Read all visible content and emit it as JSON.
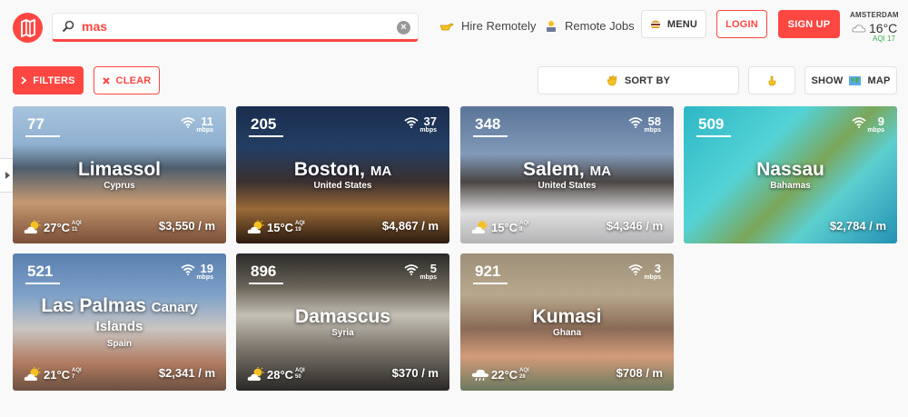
{
  "header": {
    "search": {
      "value": "mas",
      "placeholder": ""
    },
    "nav": {
      "hire_remotely": "Hire Remotely",
      "remote_jobs": "Remote Jobs"
    },
    "buttons": {
      "menu": "MENU",
      "login": "LOGIN",
      "signup": "SIGN UP"
    },
    "weather": {
      "city": "AMSTERDAM",
      "temp": "16°C",
      "aqi": "AQI 17"
    }
  },
  "toolbar": {
    "filters": "FILTERS",
    "clear": "CLEAR",
    "sort_by": "SORT BY",
    "show": "SHOW",
    "map": "MAP"
  },
  "cities": [
    {
      "rank": "77",
      "name": "Limassol",
      "state": "",
      "country": "Cyprus",
      "wifi": "11",
      "wifi_unit": "mbps",
      "temp": "27°C",
      "aqi_label": "AQI",
      "aqi": "11",
      "cost": "$3,550 / m",
      "weather": "sun-cloud"
    },
    {
      "rank": "205",
      "name": "Boston,",
      "state": "MA",
      "country": "United States",
      "wifi": "37",
      "wifi_unit": "mbps",
      "temp": "15°C",
      "aqi_label": "AQI",
      "aqi": "19",
      "cost": "$4,867 / m",
      "weather": "sun-cloud"
    },
    {
      "rank": "348",
      "name": "Salem,",
      "state": "MA",
      "country": "United States",
      "wifi": "58",
      "wifi_unit": "mbps",
      "temp": "15°C",
      "aqi_label": "AQI",
      "aqi": "8",
      "cost": "$4,346 / m",
      "weather": "sun-cloud"
    },
    {
      "rank": "509",
      "name": "Nassau",
      "state": "",
      "country": "Bahamas",
      "wifi": "9",
      "wifi_unit": "mbps",
      "temp": "",
      "aqi_label": "",
      "aqi": "",
      "cost": "$2,784 / m",
      "weather": ""
    },
    {
      "rank": "521",
      "name": "Las Palmas",
      "state": "Canary",
      "name2": "Islands",
      "country": "Spain",
      "wifi": "19",
      "wifi_unit": "mbps",
      "temp": "21°C",
      "aqi_label": "AQI",
      "aqi": "7",
      "cost": "$2,341 / m",
      "weather": "sun-cloud"
    },
    {
      "rank": "896",
      "name": "Damascus",
      "state": "",
      "country": "Syria",
      "wifi": "5",
      "wifi_unit": "mbps",
      "temp": "28°C",
      "aqi_label": "AQI",
      "aqi": "50",
      "cost": "$370 / m",
      "weather": "sun-cloud"
    },
    {
      "rank": "921",
      "name": "Kumasi",
      "state": "",
      "country": "Ghana",
      "wifi": "3",
      "wifi_unit": "mbps",
      "temp": "22°C",
      "aqi_label": "AQI",
      "aqi": "28",
      "cost": "$708 / m",
      "weather": "rain-cloud"
    }
  ],
  "colors": {
    "accent": "#ff4742",
    "aqi_good": "#3aaf50"
  }
}
